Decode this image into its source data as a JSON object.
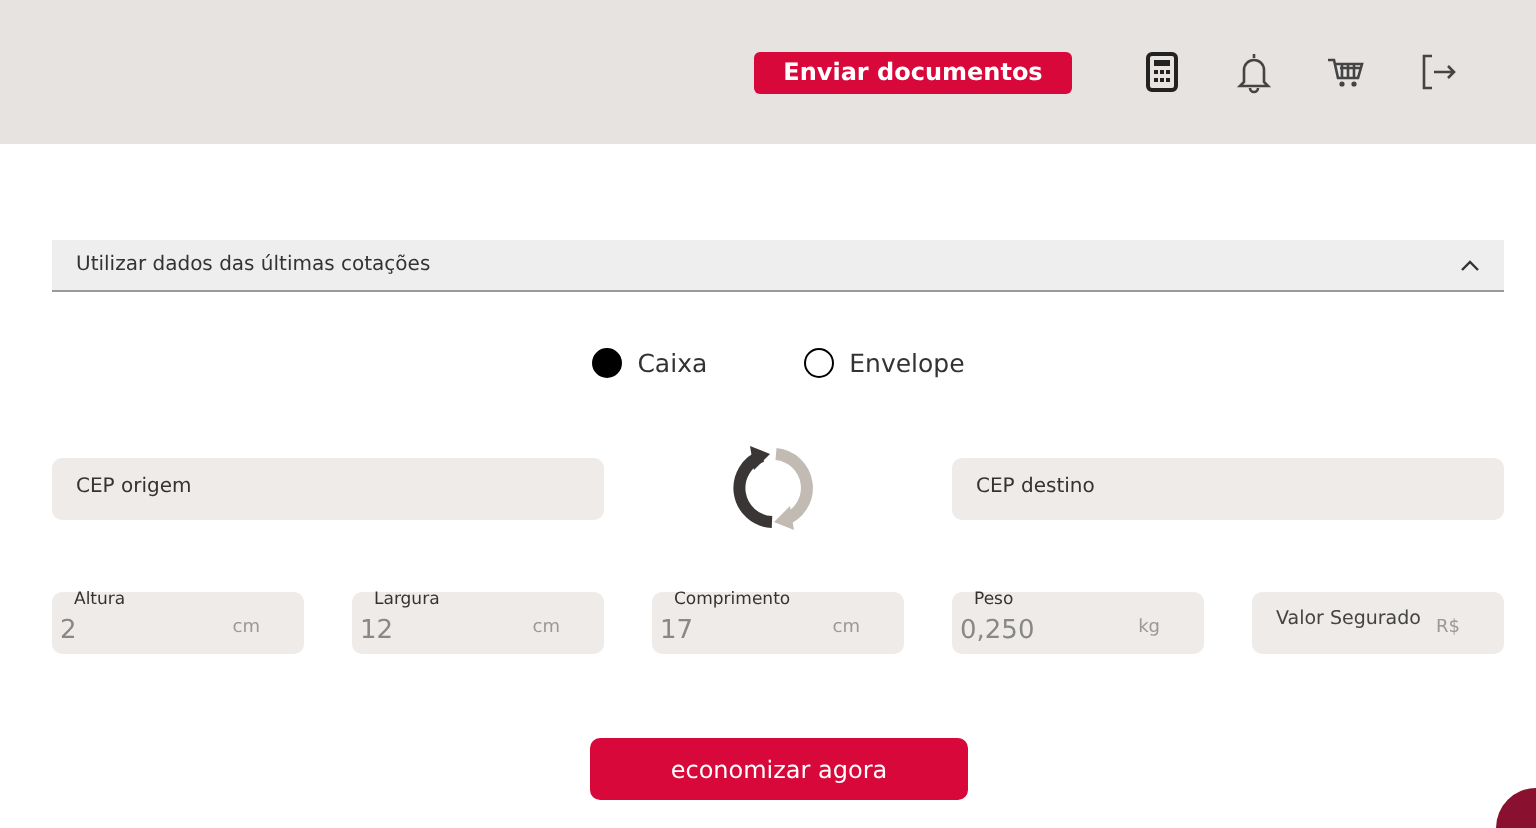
{
  "header": {
    "button": "Enviar documentos"
  },
  "accordion": {
    "label": "Utilizar dados das últimas cotações",
    "expanded": true
  },
  "package_type": [
    {
      "label": "Caixa",
      "selected": true
    },
    {
      "label": "Envelope",
      "selected": false
    }
  ],
  "cep_fields": [
    {
      "placeholder": "CEP origem"
    },
    {
      "placeholder": "CEP destino"
    }
  ],
  "measure_fields": [
    {
      "label": "Altura",
      "value": "2",
      "unit": "cm"
    },
    {
      "label": "Largura",
      "value": "12",
      "unit": "cm"
    },
    {
      "label": "Comprimento",
      "value": "17",
      "unit": "cm"
    },
    {
      "label": "Peso",
      "value": "0,250",
      "unit": "kg"
    },
    {
      "label": "Valor Segurado",
      "unit": "R$"
    }
  ],
  "submit_button": "economizar agora"
}
